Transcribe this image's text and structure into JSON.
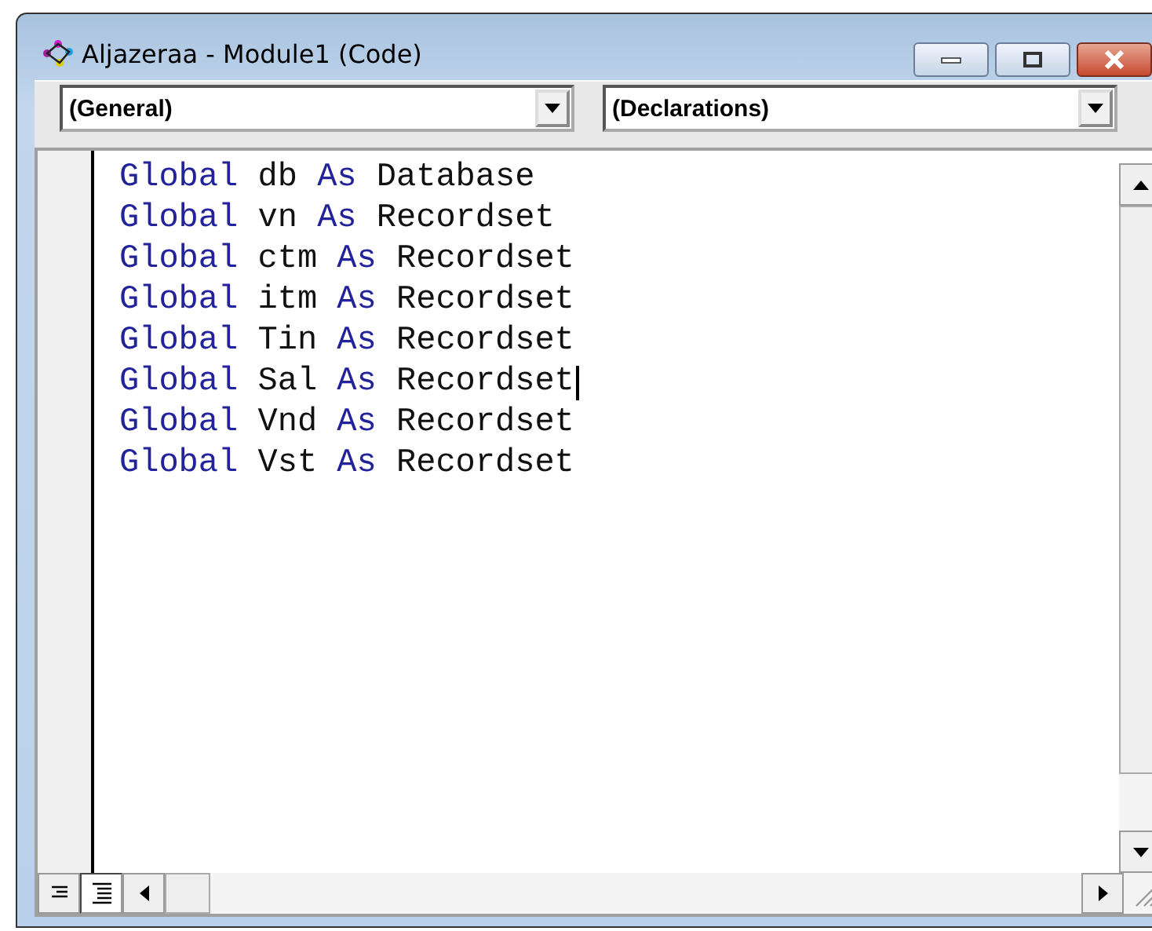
{
  "window": {
    "title": "Aljazeraa - Module1 (Code)"
  },
  "dropdowns": [
    {
      "value": "(General)"
    },
    {
      "value": "(Declarations)"
    }
  ],
  "code_lines": [
    {
      "cursor": false,
      "tokens": [
        {
          "text": "Global",
          "kind": "keyword"
        },
        {
          "text": "db",
          "kind": "plain"
        },
        {
          "text": "As",
          "kind": "keyword"
        },
        {
          "text": "Database",
          "kind": "plain"
        }
      ]
    },
    {
      "cursor": false,
      "tokens": [
        {
          "text": "Global",
          "kind": "keyword"
        },
        {
          "text": "vn",
          "kind": "plain"
        },
        {
          "text": "As",
          "kind": "keyword"
        },
        {
          "text": "Recordset",
          "kind": "plain"
        }
      ]
    },
    {
      "cursor": false,
      "tokens": [
        {
          "text": "Global",
          "kind": "keyword"
        },
        {
          "text": "ctm",
          "kind": "plain"
        },
        {
          "text": "As",
          "kind": "keyword"
        },
        {
          "text": "Recordset",
          "kind": "plain"
        }
      ]
    },
    {
      "cursor": false,
      "tokens": [
        {
          "text": "Global",
          "kind": "keyword"
        },
        {
          "text": "itm",
          "kind": "plain"
        },
        {
          "text": "As",
          "kind": "keyword"
        },
        {
          "text": "Recordset",
          "kind": "plain"
        }
      ]
    },
    {
      "cursor": false,
      "tokens": [
        {
          "text": "Global",
          "kind": "keyword"
        },
        {
          "text": "Tin",
          "kind": "plain"
        },
        {
          "text": "As",
          "kind": "keyword"
        },
        {
          "text": "Recordset",
          "kind": "plain"
        }
      ]
    },
    {
      "cursor": true,
      "tokens": [
        {
          "text": "Global",
          "kind": "keyword"
        },
        {
          "text": "Sal",
          "kind": "plain"
        },
        {
          "text": "As",
          "kind": "keyword"
        },
        {
          "text": "Recordset",
          "kind": "plain"
        }
      ]
    },
    {
      "cursor": false,
      "tokens": [
        {
          "text": "Global",
          "kind": "keyword"
        },
        {
          "text": "Vnd",
          "kind": "plain"
        },
        {
          "text": "As",
          "kind": "keyword"
        },
        {
          "text": "Recordset",
          "kind": "plain"
        }
      ]
    },
    {
      "cursor": false,
      "tokens": [
        {
          "text": "Global",
          "kind": "keyword"
        },
        {
          "text": "Vst",
          "kind": "plain"
        },
        {
          "text": "As",
          "kind": "keyword"
        },
        {
          "text": "Recordset",
          "kind": "plain"
        }
      ]
    }
  ],
  "view_buttons": [
    {
      "kind": "procedure",
      "selected": false
    },
    {
      "kind": "full_module",
      "selected": true
    }
  ]
}
